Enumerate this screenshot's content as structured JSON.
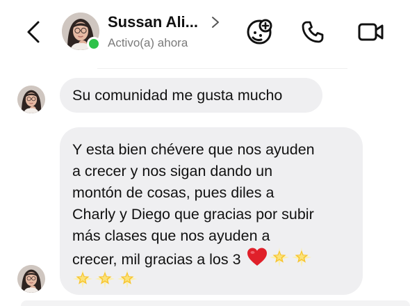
{
  "header": {
    "name": "Sussan Ali...",
    "status": "Activo(a) ahora",
    "online_color": "#2ec24a",
    "icons": [
      "back-arrow-icon",
      "chevron-right-icon",
      "sticker-add-icon",
      "phone-icon",
      "video-camera-icon"
    ]
  },
  "messages": [
    {
      "lines": [
        "Su comunidad me gusta mucho"
      ]
    },
    {
      "lines": [
        "Y esta bien chévere que nos ayuden",
        "a crecer y nos sigan dando un",
        "montón de cosas, pues diles a",
        "Charly y Diego que gracias por subir",
        "más clases que nos ayuden a",
        "crecer, mil gracias a los 3"
      ],
      "emojis": [
        "red-heart",
        "glowing-star",
        "glowing-star",
        "glowing-star",
        "glowing-star",
        "glowing-star"
      ]
    }
  ],
  "colors": {
    "bubble": "#efeff1",
    "heart": "#e0202a",
    "star": "#f7c531"
  }
}
